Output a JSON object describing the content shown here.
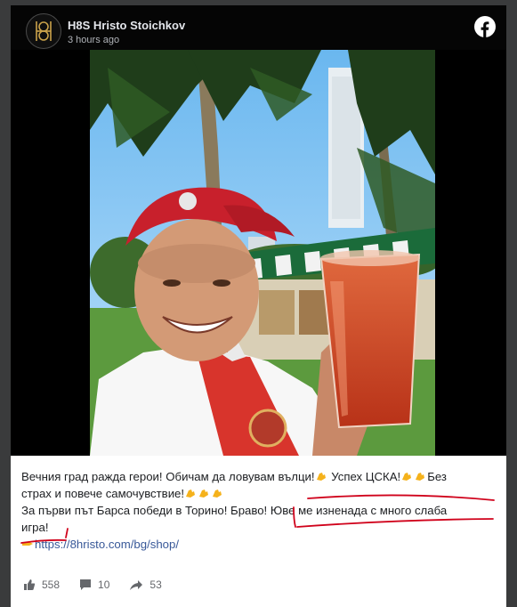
{
  "post": {
    "author": "H8S Hristo Stoichkov",
    "avatar_text": "H8S",
    "time": "3 hours ago",
    "caption": {
      "line1": "Вечния град ражда герои! Обичам да ловувам вълци!",
      "line1b": " Успех ЦСКА!",
      "line1c": "Без",
      "line2": "страх и повече самочувствие!",
      "line3": "За първи път Барса победи в Торино! Браво!",
      "line3b": "Юве ме изненада с много слаба",
      "line4": "игра!",
      "link": "https://8hristo.com/bg/shop/"
    },
    "stats": {
      "likes": "558",
      "comments": "10",
      "shares": "53"
    }
  },
  "icons": {
    "facebook": "facebook-icon",
    "like": "thumbs-up-icon",
    "comment": "comment-icon",
    "share": "share-icon",
    "muscle": "flexed-biceps-emoji",
    "pointer": "pointing-right-emoji"
  },
  "colors": {
    "header_bg": "#050505",
    "panel_bg": "#ffffff",
    "link": "#385898",
    "highlight_ink": "#d0021b"
  }
}
